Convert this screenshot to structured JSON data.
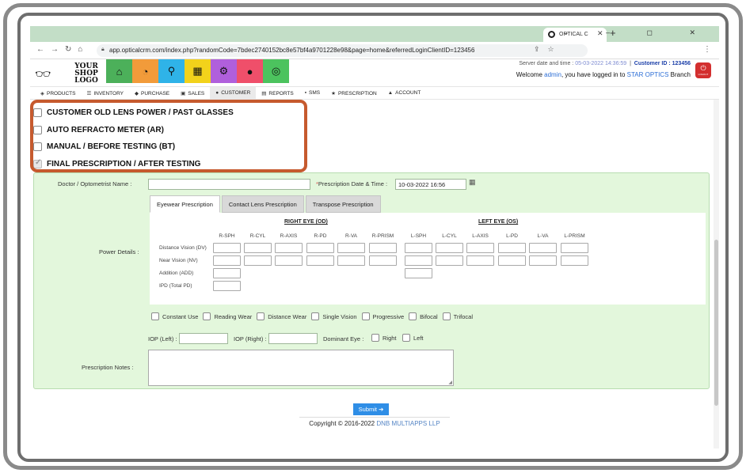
{
  "browser": {
    "tab_title": "OPTICAL C",
    "tab_close": "✕",
    "new_tab": "+",
    "url": "app.opticalcrm.com/index.php?randomCode=7bdec2740152bc8e57bf4a9701228e98&page=home&referredLoginClientID=123456",
    "window_buttons": "⌄ – ◻ ✕"
  },
  "header": {
    "logo_line1": "YOUR",
    "logo_line2": "SHOP LOGO",
    "server_label": "Server date and time : ",
    "server_time": "05-03-2022 14:36:59",
    "customer_id_label": "Customer ID : 123456",
    "welcome_prefix": "Welcome ",
    "user": "admin",
    "welcome_mid": ", you have logged in to ",
    "branch": "STAR OPTICS",
    "welcome_suffix": " Branch",
    "logout_label": "LOGOUT",
    "tiles": [
      {
        "icon": "home-icon",
        "glyph": "⌂",
        "color": "#4cb05a"
      },
      {
        "icon": "dashboard-icon",
        "glyph": "◔",
        "color": "#f29b3a"
      },
      {
        "icon": "search-icon",
        "glyph": "⚲",
        "color": "#2fb3e8"
      },
      {
        "icon": "grid-icon",
        "glyph": "▦",
        "color": "#f2d21b"
      },
      {
        "icon": "gear-icon",
        "glyph": "⚙",
        "color": "#b05fdc"
      },
      {
        "icon": "user-icon",
        "glyph": "●",
        "color": "#ef4f6a"
      },
      {
        "icon": "whatsapp-icon",
        "glyph": "◎",
        "color": "#4cc35e"
      }
    ]
  },
  "menu": [
    {
      "label": "PRODUCTS",
      "icon": "cube-icon",
      "glyph": "◈"
    },
    {
      "label": "INVENTORY",
      "icon": "list-icon",
      "glyph": "☰"
    },
    {
      "label": "PURCHASE",
      "icon": "tag-icon",
      "glyph": "◆"
    },
    {
      "label": "SALES",
      "icon": "cart-icon",
      "glyph": "▣"
    },
    {
      "label": "CUSTOMER",
      "icon": "user-icon",
      "glyph": "●"
    },
    {
      "label": "REPORTS",
      "icon": "chart-icon",
      "glyph": "▤"
    },
    {
      "label": "SMS",
      "icon": "chat-icon",
      "glyph": "▪"
    },
    {
      "label": "PRESCRIPTION",
      "icon": "star-icon",
      "glyph": "★"
    },
    {
      "label": "ACCOUNT",
      "icon": "lock-icon",
      "glyph": "▲"
    }
  ],
  "options": [
    {
      "label": "CUSTOMER OLD LENS POWER / PAST GLASSES",
      "checked": false
    },
    {
      "label": "AUTO REFRACTO METER (AR)",
      "checked": false
    },
    {
      "label": "MANUAL / BEFORE TESTING (BT)",
      "checked": false
    },
    {
      "label": "FINAL PRESCRIPTION / AFTER TESTING",
      "checked": true
    }
  ],
  "form": {
    "doctor_label": "Doctor / Optometrist Name :",
    "doctor_value": "",
    "req_mark": "*",
    "date_label": "Prescription Date & Time :",
    "date_value": "10-03-2022 16:56",
    "tabs": [
      "Eyewear Prescription",
      "Contact Lens Prescription",
      "Transpose Prescription"
    ],
    "power_label": "Power Details :",
    "right_eye": "RIGHT EYE (OD)",
    "left_eye": "LEFT EYE (OS)",
    "right_cols": [
      "R-SPH",
      "R-CYL",
      "R-AXIS",
      "R-PD",
      "R-VA",
      "R-PRISM"
    ],
    "left_cols": [
      "L-SPH",
      "L-CYL",
      "L-AXIS",
      "L-PD",
      "L-VA",
      "L-PRISM"
    ],
    "rows": [
      "Distance Vision (DV)",
      "Near Vision (NV)",
      "Addition (ADD)",
      "IPD (Total PD)"
    ],
    "usage": [
      "Constant Use",
      "Reading Wear",
      "Distance Wear",
      "Single Vision",
      "Progressive",
      "Bifocal",
      "Trifocal"
    ],
    "iop_left": "IOP (Left) :",
    "iop_right": "IOP (Right) :",
    "dominant_eye": "Dominant Eye :",
    "eye_right": "Right",
    "eye_left": "Left",
    "notes_label": "Prescription Notes :"
  },
  "submit_label": "Submit",
  "copyright_prefix": "Copyright © 2016-2022 ",
  "copyright_company": "DNB MULTIAPPS LLP"
}
